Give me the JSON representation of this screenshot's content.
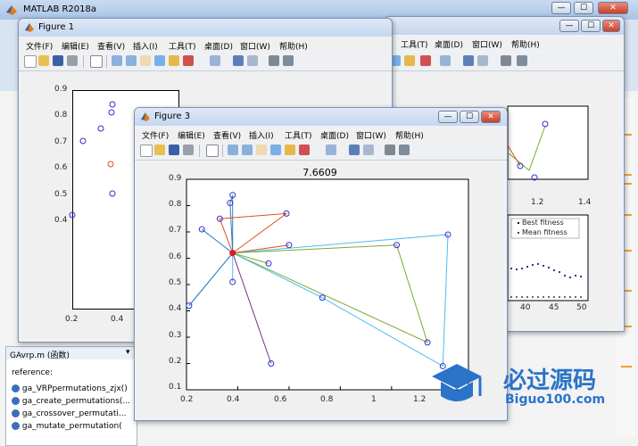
{
  "app": {
    "title": "MATLAB R2018a",
    "controls": [
      "—",
      "☐",
      "✕"
    ]
  },
  "menu": [
    "文件(F)",
    "编辑(E)",
    "查看(V)",
    "插入(I)",
    "工具(T)",
    "桌面(D)",
    "窗口(W)",
    "帮助(H)"
  ],
  "figure1": {
    "title": "Figure 1",
    "yticks": [
      "0.9",
      "0.8",
      "0.7",
      "0.6",
      "0.5",
      "0.4"
    ],
    "xticks": [
      "0.2",
      "0.4"
    ]
  },
  "figure2": {
    "menu_partial": [
      "工具(T)",
      "桌面(D)",
      "窗口(W)",
      "帮助(H)"
    ],
    "xticks": [
      "1.2",
      "1.4"
    ],
    "xticks2": [
      "40",
      "45",
      "50"
    ],
    "legend": [
      "Best fitness",
      "Mean fitness"
    ]
  },
  "figure3": {
    "title": "Figure 3",
    "plot_title": "7.6609",
    "yticks": [
      "0.9",
      "0.8",
      "0.7",
      "0.6",
      "0.5",
      "0.4",
      "0.3",
      "0.2",
      "0.1"
    ],
    "xticks": [
      "0.2",
      "0.4",
      "0.6",
      "0.8",
      "1",
      "1.2"
    ]
  },
  "workspace": {
    "file_label": "GAvrp.m (函数)",
    "reference_label": "reference:",
    "functions": [
      "ga_VRPpermutations_zjx()",
      "ga_create_permutations(...",
      "ga_crossover_permutati...",
      "ga_mutate_permutation("
    ]
  },
  "watermark": {
    "text": "必过源码",
    "url": "Biguo100.com"
  },
  "colors": {
    "marker": "#3030d0",
    "depot": "#d02020",
    "routes": [
      "#2f7fc1",
      "#d95319",
      "#77ac30",
      "#4dbeee",
      "#7e2f8e",
      "#0072bd"
    ]
  },
  "chart_data": {
    "type": "scatter",
    "title": "7.6609",
    "xlim": [
      0.2,
      1.3
    ],
    "ylim": [
      0.1,
      0.9
    ],
    "depot": [
      0.38,
      0.62
    ],
    "customers": [
      [
        0.38,
        0.84
      ],
      [
        0.37,
        0.81
      ],
      [
        0.33,
        0.75
      ],
      [
        0.59,
        0.77
      ],
      [
        0.26,
        0.71
      ],
      [
        0.6,
        0.65
      ],
      [
        0.52,
        0.58
      ],
      [
        1.02,
        0.65
      ],
      [
        1.22,
        0.69
      ],
      [
        0.73,
        0.45
      ],
      [
        1.14,
        0.28
      ],
      [
        1.2,
        0.19
      ],
      [
        0.38,
        0.51
      ],
      [
        0.21,
        0.42
      ],
      [
        0.53,
        0.2
      ]
    ],
    "routes": [
      [
        [
          0.38,
          0.62
        ],
        [
          0.38,
          0.84
        ],
        [
          0.37,
          0.81
        ],
        [
          0.38,
          0.62
        ]
      ],
      [
        [
          0.38,
          0.62
        ],
        [
          0.33,
          0.75
        ],
        [
          0.59,
          0.77
        ],
        [
          0.38,
          0.62
        ]
      ],
      [
        [
          0.38,
          0.62
        ],
        [
          1.02,
          0.65
        ],
        [
          1.14,
          0.28
        ],
        [
          0.38,
          0.62
        ]
      ],
      [
        [
          0.38,
          0.62
        ],
        [
          1.22,
          0.69
        ],
        [
          1.2,
          0.19
        ],
        [
          0.73,
          0.45
        ],
        [
          0.38,
          0.62
        ]
      ],
      [
        [
          0.38,
          0.62
        ],
        [
          0.53,
          0.2
        ],
        [
          0.38,
          0.62
        ]
      ],
      [
        [
          0.38,
          0.62
        ],
        [
          0.21,
          0.42
        ],
        [
          0.38,
          0.62
        ]
      ],
      [
        [
          0.38,
          0.62
        ],
        [
          0.26,
          0.71
        ],
        [
          0.38,
          0.62
        ]
      ],
      [
        [
          0.38,
          0.62
        ],
        [
          0.6,
          0.65
        ],
        [
          0.38,
          0.62
        ]
      ],
      [
        [
          0.38,
          0.62
        ],
        [
          0.52,
          0.58
        ],
        [
          0.38,
          0.62
        ]
      ],
      [
        [
          0.38,
          0.62
        ],
        [
          0.38,
          0.51
        ],
        [
          0.38,
          0.62
        ]
      ]
    ]
  }
}
